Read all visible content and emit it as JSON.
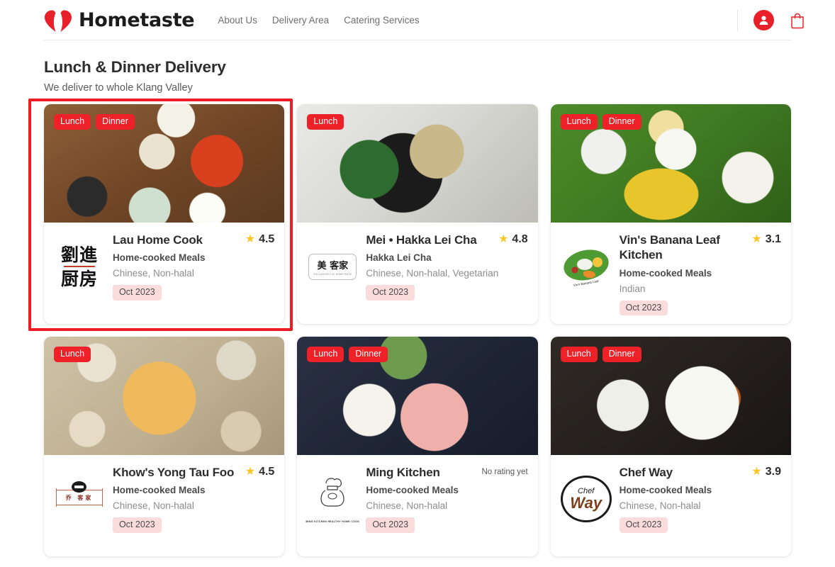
{
  "header": {
    "brand_name": "Hometaste",
    "logo_icon": "heart-fork-spoon-icon",
    "nav": [
      {
        "label": "About Us"
      },
      {
        "label": "Delivery Area"
      },
      {
        "label": "Catering Services"
      }
    ],
    "account_icon": "user-avatar-icon",
    "cart_icon": "shopping-bag-icon"
  },
  "page": {
    "title": "Lunch & Dinner Delivery",
    "subtitle": "We deliver to whole Klang Valley"
  },
  "colors": {
    "brand_red": "#ee2128",
    "selection_red": "#ee1d23",
    "badge_red": "#ee2128",
    "star_yellow": "#ffc526",
    "date_pill_bg": "#fadcdc",
    "text_dark": "#2d2d2d",
    "text_muted": "#8d8d8d"
  },
  "cards": [
    {
      "name": "Lau Home Cook",
      "category": "Home-cooked Meals",
      "tags": "Chinese, Non-halal",
      "date": "Oct 2023",
      "rating": "4.5",
      "has_rating": true,
      "badges": [
        "Lunch",
        "Dinner"
      ],
      "logo_text_top": "劉進",
      "logo_text_bottom": "厨房",
      "selected": true,
      "photo": "chinese-set-meal-photo"
    },
    {
      "name": "Mei • Hakka Lei Cha",
      "category": "Hakka Lei Cha",
      "tags": "Chinese, Non-halal, Vegetarian",
      "date": "Oct 2023",
      "rating": "4.8",
      "has_rating": true,
      "badges": [
        "Lunch"
      ],
      "logo_text_top": "美 客家",
      "logo_text_bottom": "EXCLUSIVELY AT HOMETASTE",
      "selected": false,
      "photo": "lei-cha-bowl-photo"
    },
    {
      "name": "Vin's Banana Leaf Kitchen",
      "category": "Home-cooked Meals",
      "tags": "Indian",
      "date": "Oct 2023",
      "rating": "3.1",
      "has_rating": true,
      "badges": [
        "Lunch",
        "Dinner"
      ],
      "logo_text_top": "",
      "logo_text_bottom": "Vin's Banana Leaf",
      "selected": false,
      "photo": "banana-leaf-rice-photo"
    },
    {
      "name": "Khow's Yong Tau Foo",
      "category": "Home-cooked Meals",
      "tags": "Chinese, Non-halal",
      "date": "Oct 2023",
      "rating": "4.5",
      "has_rating": true,
      "badges": [
        "Lunch"
      ],
      "logo_text_top": "乔 客家",
      "logo_text_bottom": "",
      "selected": false,
      "photo": "yong-tau-foo-platter-photo"
    },
    {
      "name": "Ming Kitchen",
      "category": "Home-cooked Meals",
      "tags": "Chinese, Non-halal",
      "date": "Oct 2023",
      "rating": "",
      "no_rating_label": "No rating yet",
      "has_rating": false,
      "badges": [
        "Lunch",
        "Dinner"
      ],
      "logo_text_top": "",
      "logo_text_bottom": "MING KITCHEN HEALTHY HOME COOK",
      "selected": false,
      "photo": "rice-egg-soup-tray-photo"
    },
    {
      "name": "Chef Way",
      "category": "Home-cooked Meals",
      "tags": "Chinese, Non-halal",
      "date": "Oct 2023",
      "rating": "3.9",
      "has_rating": true,
      "badges": [
        "Lunch",
        "Dinner"
      ],
      "logo_text_top": "Chef",
      "logo_text_bottom": "Way",
      "selected": false,
      "photo": "chinese-rice-dishes-photo"
    }
  ]
}
